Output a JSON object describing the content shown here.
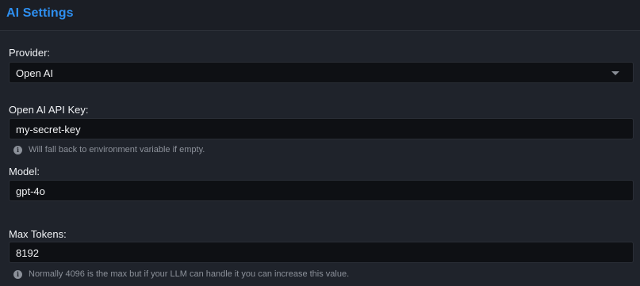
{
  "panel": {
    "title": "AI Settings"
  },
  "provider": {
    "label": "Provider:",
    "selected": "Open AI"
  },
  "api_key": {
    "label": "Open AI API Key:",
    "value": "my-secret-key",
    "hint": "Will fall back to environment variable if empty."
  },
  "model": {
    "label": "Model:",
    "value": "gpt-4o"
  },
  "max_tokens": {
    "label": "Max Tokens:",
    "value": "8192",
    "hint": "Normally 4096 is the max but if your LLM can handle it you can increase this value."
  },
  "icons": {
    "dropdown": "chevron-down-icon",
    "hint": "info-icon"
  },
  "colors": {
    "title_accent": "#2e8ff0",
    "background": "#1f232b",
    "field_background": "#0e1014",
    "hint_text": "#8c919a"
  }
}
